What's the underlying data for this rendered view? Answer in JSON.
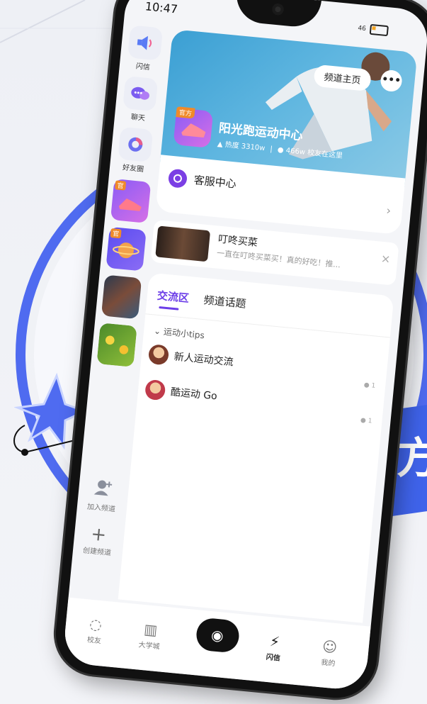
{
  "status": {
    "time": "10:47",
    "signal": "46"
  },
  "rail": {
    "items": [
      {
        "label": "闪信",
        "icon": "speaker-icon"
      },
      {
        "label": "聊天",
        "icon": "chat-bubble-icon"
      },
      {
        "label": "好友圈",
        "icon": "friends-circle-icon"
      }
    ],
    "badge_text": "官"
  },
  "hero": {
    "home_button": "频道主页",
    "more": "•••",
    "badge": "官方",
    "title": "阳光跑运动中心",
    "heat_label": "热度 3310w",
    "members_label": "466w 校友在这里"
  },
  "service": {
    "label": "客服中心",
    "arrow": "›"
  },
  "news": {
    "title": "叮咚买菜",
    "subtitle": "一直在叮咚买菜买！真的好吃！推...",
    "close": "×"
  },
  "tabs": [
    {
      "label": "交流区"
    },
    {
      "label": "频道话题"
    }
  ],
  "section": {
    "title": "运动小tips"
  },
  "channels": [
    {
      "name": "新人运动交流",
      "count": "1"
    },
    {
      "name": "酷运动 Go",
      "count": "1"
    }
  ],
  "side_actions": [
    {
      "label": "加入频道",
      "icon": "join-channel-icon"
    },
    {
      "label": "创建频道",
      "icon": "plus-icon"
    }
  ],
  "nav": [
    {
      "label": "校友",
      "icon": "alumni-icon"
    },
    {
      "label": "大学城",
      "icon": "building-icon"
    },
    {
      "label": "闪信",
      "icon": "flash-icon"
    },
    {
      "label": "我的",
      "icon": "profile-icon"
    }
  ],
  "banner_char": "方",
  "colors": {
    "accent": "#6c3ee8",
    "brand_blue": "#4f6bf0"
  }
}
